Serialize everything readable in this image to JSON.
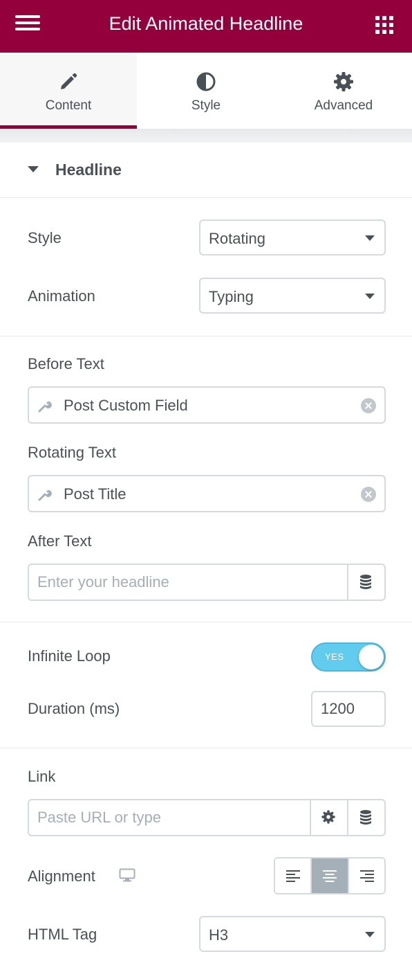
{
  "header": {
    "title": "Edit Animated Headline",
    "menu_icon": "hamburger-icon",
    "apps_icon": "grid-icon"
  },
  "tabs": [
    {
      "label": "Content",
      "icon": "pencil-icon",
      "active": true
    },
    {
      "label": "Style",
      "icon": "half-circle-icon",
      "active": false
    },
    {
      "label": "Advanced",
      "icon": "gear-icon",
      "active": false
    }
  ],
  "section": {
    "title": "Headline",
    "expanded": true
  },
  "fields": {
    "style": {
      "label": "Style",
      "value": "Rotating"
    },
    "animation": {
      "label": "Animation",
      "value": "Typing"
    },
    "before_text": {
      "label": "Before Text",
      "value": "Post Custom Field"
    },
    "rotating_text": {
      "label": "Rotating Text",
      "value": "Post Title"
    },
    "after_text": {
      "label": "After Text",
      "placeholder": "Enter your headline"
    },
    "infinite_loop": {
      "label": "Infinite Loop",
      "toggle_text": "YES",
      "on": true
    },
    "duration": {
      "label": "Duration (ms)",
      "value": "1200"
    },
    "link": {
      "label": "Link",
      "placeholder": "Paste URL or type"
    },
    "alignment": {
      "label": "Alignment",
      "selected": "center",
      "options": [
        "left",
        "center",
        "right"
      ]
    },
    "html_tag": {
      "label": "HTML Tag",
      "value": "H3"
    }
  },
  "colors": {
    "brand": "#93003c",
    "toggle_on": "#61ccee",
    "text": "#495157",
    "active_align": "#a4afb7"
  }
}
